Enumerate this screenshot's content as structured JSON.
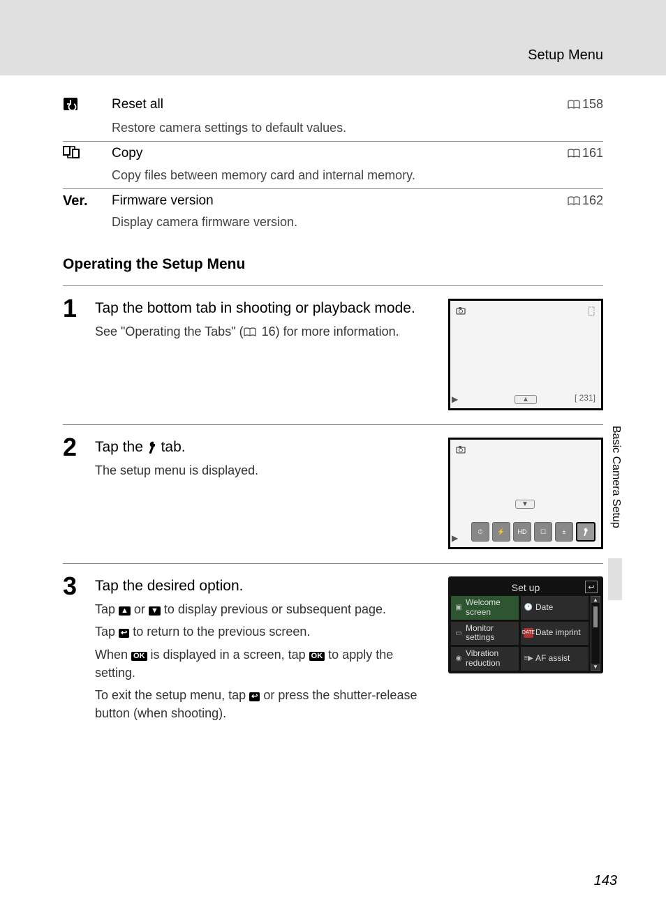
{
  "header": "Setup Menu",
  "menu": [
    {
      "icon_label": "reset-icon",
      "title": "Reset all",
      "desc": "Restore camera settings to default values.",
      "page": "158"
    },
    {
      "icon_label": "copy-icon",
      "title": "Copy",
      "desc": "Copy files between memory card and internal memory.",
      "page": "161"
    },
    {
      "icon_label": "ver-icon",
      "icon_text": "Ver.",
      "title": "Firmware version",
      "desc": "Display camera firmware version.",
      "page": "162"
    }
  ],
  "section_heading": "Operating the Setup Menu",
  "steps": {
    "s1": {
      "num": "1",
      "instr": "Tap the bottom tab in shooting or playback mode.",
      "desc_prefix": "See \"Operating the Tabs\" (",
      "desc_page": "16",
      "desc_suffix": ") for more information.",
      "screen": {
        "counter": "231"
      }
    },
    "s2": {
      "num": "2",
      "instr_prefix": "Tap the ",
      "instr_suffix": " tab.",
      "desc": "The setup menu is displayed."
    },
    "s3": {
      "num": "3",
      "instr": "Tap the desired option.",
      "d1_prefix": "Tap ",
      "d1_mid": " or ",
      "d1_suffix": " to display previous or subsequent page.",
      "d2_prefix": "Tap ",
      "d2_suffix": " to return to the previous screen.",
      "d3_prefix": "When ",
      "d3_mid": " is displayed in a screen, tap ",
      "d3_suffix": " to apply the setting.",
      "d4_prefix": "To exit the setup menu, tap ",
      "d4_suffix": " or press the shutter-release button (when shooting).",
      "setup": {
        "title": "Set up",
        "items": [
          {
            "label": "Welcome screen"
          },
          {
            "label": "Date"
          },
          {
            "label": "Monitor settings"
          },
          {
            "label": "Date imprint"
          },
          {
            "label": "Vibration reduction"
          },
          {
            "label": "AF assist"
          }
        ]
      }
    }
  },
  "side_tab": "Basic Camera Setup",
  "page_number": "143"
}
